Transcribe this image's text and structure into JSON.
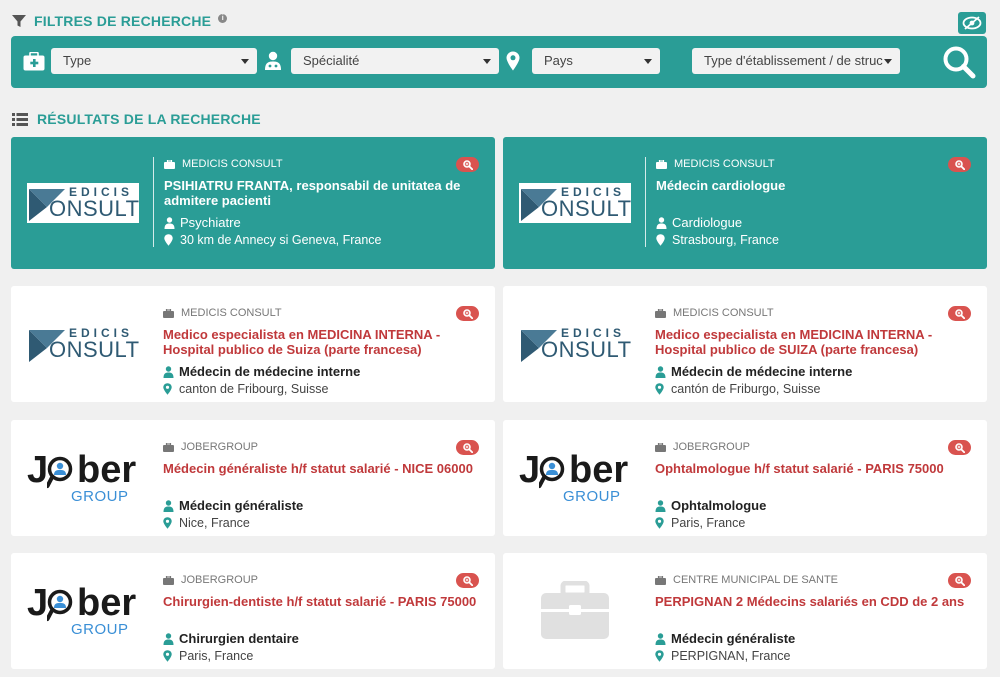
{
  "filters": {
    "title": "FILTRES DE RECHERCHE",
    "info": "i",
    "type_value": "Type",
    "specialite_value": "Spécialité",
    "pays_value": "Pays",
    "etablissement_value": "Type d'établissement / de struc"
  },
  "results": {
    "title": "RÉSULTATS DE LA RECHERCHE",
    "cards": [
      {
        "company": "MEDICIS CONSULT",
        "title": "PSIHIATRU FRANTA, responsabil de unitatea de admitere pacienti",
        "specialty": "Psychiatre",
        "location": "30 km de Annecy si Geneva, France",
        "logo": "edicis-consult"
      },
      {
        "company": "MEDICIS CONSULT",
        "title": "Médecin cardiologue",
        "specialty": "Cardiologue",
        "location": "Strasbourg, France",
        "logo": "edicis-consult"
      },
      {
        "company": "MEDICIS CONSULT",
        "title": "Medico especialista en MEDICINA INTERNA - Hospital publico de Suiza (parte francesa)",
        "specialty": "Médecin de médecine interne",
        "location": "canton de Fribourg, Suisse",
        "logo": "edicis-consult"
      },
      {
        "company": "MEDICIS CONSULT",
        "title": "Medico especialista en MEDICINA INTERNA - Hospital publico de SUIZA (parte francesa)",
        "specialty": "Médecin de médecine interne",
        "location": "cantón de Friburgo, Suisse",
        "logo": "edicis-consult"
      },
      {
        "company": "JOBERGROUP",
        "title": "Médecin généraliste h/f statut salarié - NICE 06000",
        "specialty": "Médecin généraliste",
        "location": "Nice, France",
        "logo": "jober-group"
      },
      {
        "company": "JOBERGROUP",
        "title": "Ophtalmologue h/f statut salarié - PARIS 75000",
        "specialty": "Ophtalmologue",
        "location": "Paris, France",
        "logo": "jober-group"
      },
      {
        "company": "JOBERGROUP",
        "title": "Chirurgien-dentiste h/f statut salarié - PARIS 75000",
        "specialty": "Chirurgien dentaire",
        "location": "Paris, France",
        "logo": "jober-group"
      },
      {
        "company": "CENTRE MUNICIPAL DE SANTE",
        "title": "PERPIGNAN 2 Médecins salariés en CDD de 2 ans",
        "specialty": "Médecin généraliste",
        "location": "PERPIGNAN, France",
        "logo": "placeholder-briefcase"
      }
    ]
  },
  "logos": {
    "edicis_top": "EDICIS",
    "edicis_bottom": "ONSULT",
    "jober_a": "J",
    "jober_b": "ber",
    "jober_group": "GROUP"
  },
  "colors": {
    "accent": "#2a9d96",
    "title_red": "#c0393b",
    "badge_red": "#d9534f",
    "background": "#f0f0f0"
  }
}
